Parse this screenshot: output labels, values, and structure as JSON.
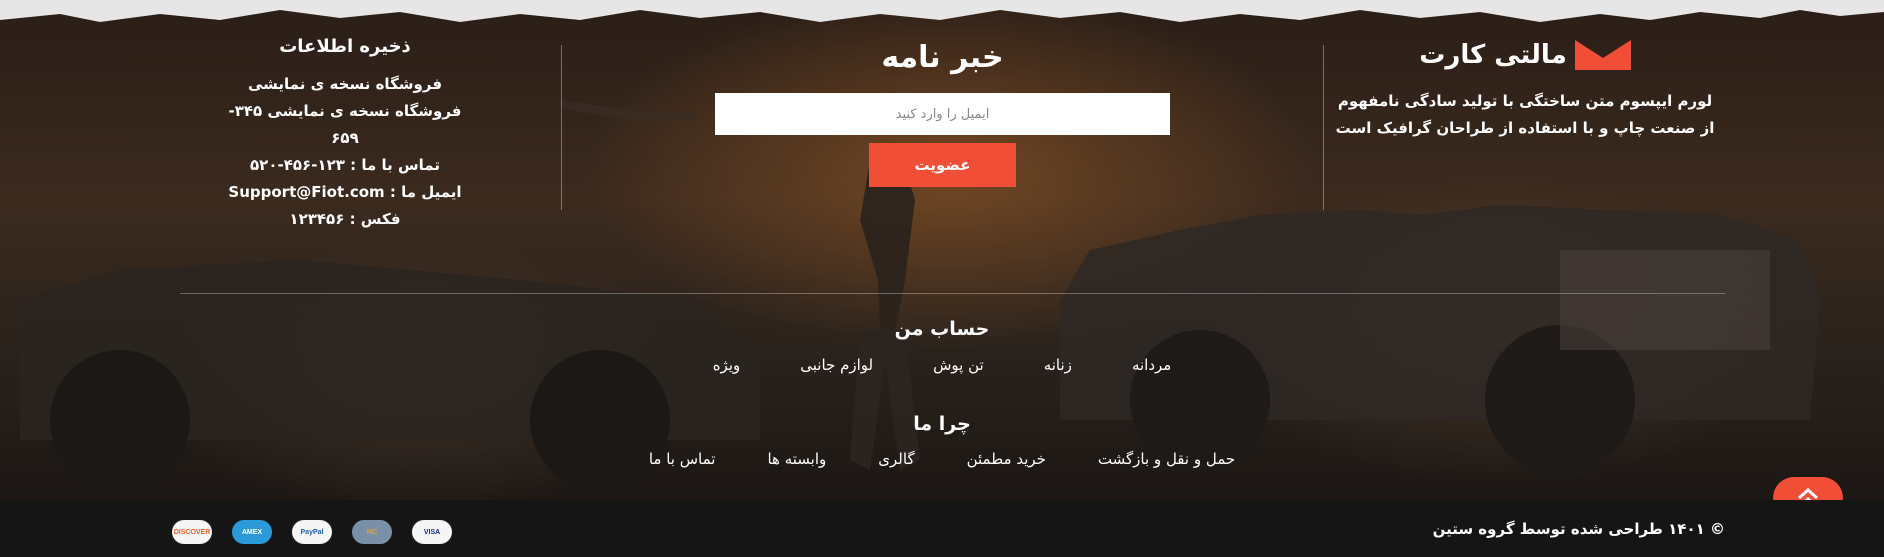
{
  "brand": {
    "title": "مالتی کارت",
    "description": "لورم ایپسوم متن ساختگی با تولید سادگی نامفهوم از صنعت چاپ و با استفاده از طراحان گرافیک است",
    "accent": "#f04e37"
  },
  "newsletter": {
    "title": "خبر نامه",
    "email_placeholder": "ایمیل را وارد کنید",
    "join_label": "عضویت"
  },
  "info": {
    "title": "ذخیره اطلاعات",
    "lines": [
      "فروشگاه نسخه ی نمایشی",
      "فروشگاه نسخه ی نمایشی ۳۴۵-",
      "۶۵۹",
      "تماس با ما : ۱۲۳-۴۵۶-۵۲۰",
      "ایمیل ما : Support@Fiot.com",
      "فکس : ۱۲۳۴۵۶"
    ]
  },
  "account": {
    "title": "حساب من",
    "links": [
      "مردانه",
      "زنانه",
      "تن پوش",
      "لوازم جانبی",
      "ویژه"
    ]
  },
  "why": {
    "title": "چرا ما",
    "links": [
      "حمل و نقل و بازگشت",
      "خرید مطمئن",
      "گالری",
      "وابسته ها",
      "تماس با ما"
    ]
  },
  "footer": {
    "copyright": "© ۱۴۰۱ طراحی شده توسط گروه ستین",
    "payments": [
      {
        "label": "VISA",
        "icon": "visa-icon",
        "bg": "#f5f5f5",
        "fg": "#1a2a8a"
      },
      {
        "label": "MC",
        "icon": "mastercard-icon",
        "bg": "#7a8fa8",
        "fg": "#e8a020"
      },
      {
        "label": "PayPal",
        "icon": "paypal-icon",
        "bg": "#f5f5f5",
        "fg": "#1b5ba8"
      },
      {
        "label": "AMEX",
        "icon": "amex-icon",
        "bg": "#2a9ad8",
        "fg": "#ffffff"
      },
      {
        "label": "DISCOVER",
        "icon": "discover-icon",
        "bg": "#f5f5f5",
        "fg": "#e8602a"
      }
    ]
  }
}
